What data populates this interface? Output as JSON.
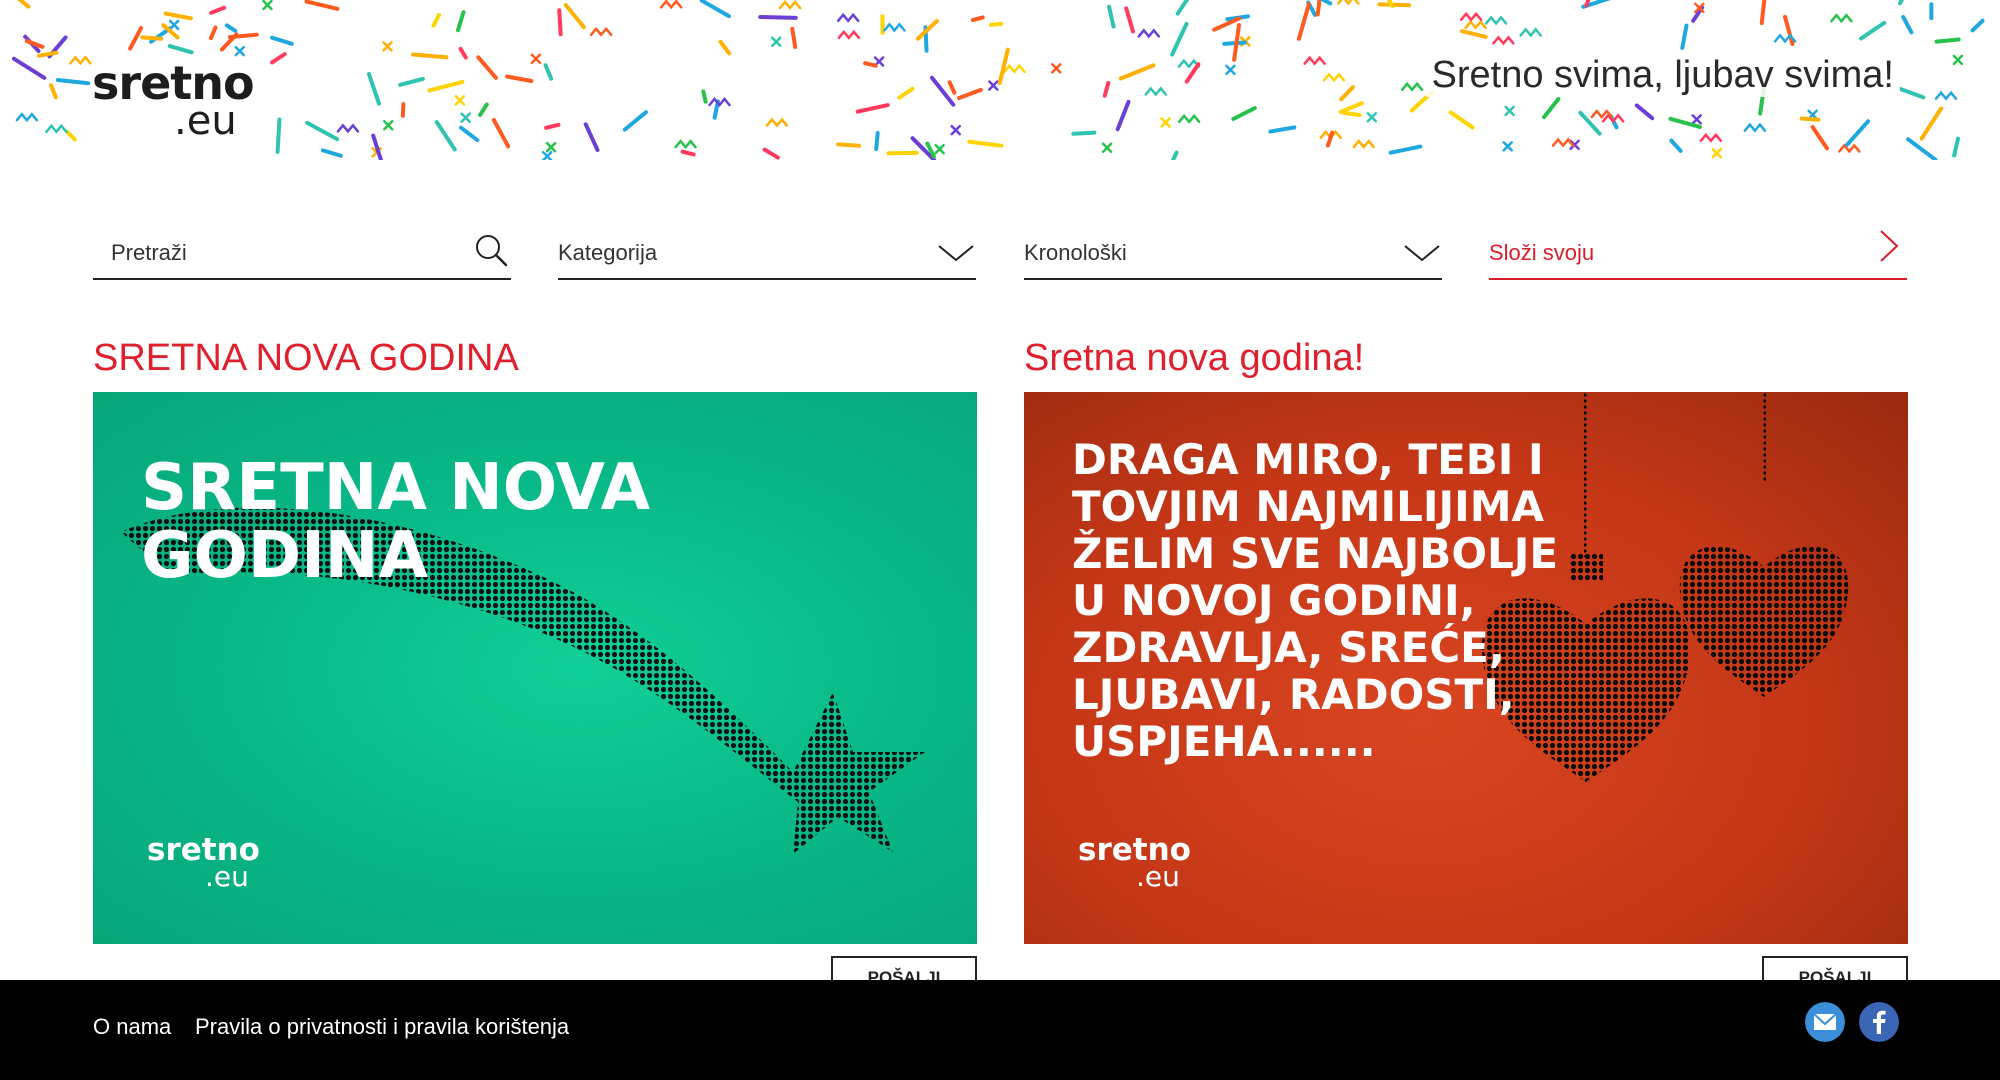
{
  "header": {
    "logo_line1": "sretno",
    "logo_line2": ".eu",
    "tagline": "Sretno svima, ljubav svima!"
  },
  "filters": {
    "search_placeholder": "Pretraži",
    "category_label": "Kategorija",
    "chronological_label": "Kronološki",
    "compose_label": "Složi svoju"
  },
  "cards": [
    {
      "title": "SRETNA NOVA GODINA",
      "image_text": "SRETNA NOVA\nGODINA",
      "logo_line1": "sretno",
      "logo_line2": ".eu",
      "button_label": "POŠALJI",
      "bg_color": "#0bbd8a"
    },
    {
      "title": "Sretna nova godina!",
      "image_text": "DRAGA MIRO, TEBI I\nTOVJIM NAJMILIJIMA\nŽELIM SVE NAJBOLJE\nU NOVOJ GODINI,\nZDRAVLJA, SREĆE,\nLJUBAVI, RADOSTI,\nUSPJEHA......",
      "logo_line1": "sretno",
      "logo_line2": ".eu",
      "button_label": "POŠALJI",
      "bg_color": "#c83a18"
    }
  ],
  "footer": {
    "about_label": "O nama",
    "privacy_label": "Pravila o privatnosti i pravila korištenja"
  },
  "colors": {
    "accent_red": "#e0202c",
    "mail_blue": "#3a8fd8",
    "facebook_blue": "#3b66b5"
  },
  "icons": [
    "search-icon",
    "chevron-down-icon",
    "chevron-right-icon",
    "mail-icon",
    "facebook-icon"
  ]
}
